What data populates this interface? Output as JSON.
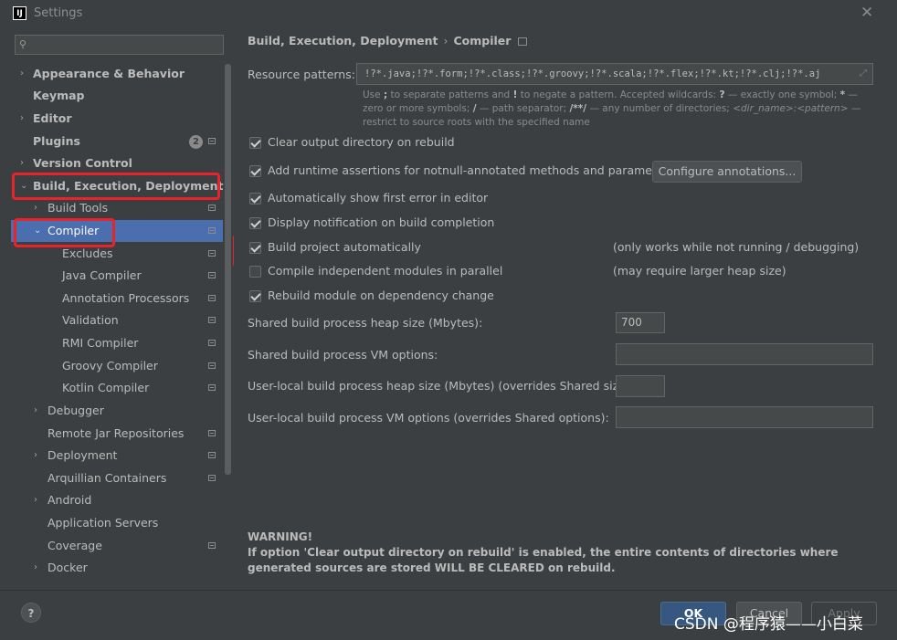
{
  "window": {
    "title": "Settings",
    "logo_text": "IJ"
  },
  "search": {
    "placeholder": ""
  },
  "sidebar": {
    "items": [
      {
        "label": "Appearance & Behavior",
        "arrow": "›"
      },
      {
        "label": "Keymap"
      },
      {
        "label": "Editor",
        "arrow": "›"
      },
      {
        "label": "Plugins",
        "badge": "2"
      },
      {
        "label": "Version Control",
        "arrow": "›"
      },
      {
        "label": "Build, Execution, Deployment",
        "arrow": "⌄"
      },
      {
        "label": "Build Tools",
        "arrow": "›"
      },
      {
        "label": "Compiler",
        "arrow": "⌄"
      },
      {
        "label": "Excludes"
      },
      {
        "label": "Java Compiler"
      },
      {
        "label": "Annotation Processors"
      },
      {
        "label": "Validation"
      },
      {
        "label": "RMI Compiler"
      },
      {
        "label": "Groovy Compiler"
      },
      {
        "label": "Kotlin Compiler"
      },
      {
        "label": "Debugger",
        "arrow": "›"
      },
      {
        "label": "Remote Jar Repositories"
      },
      {
        "label": "Deployment",
        "arrow": "›"
      },
      {
        "label": "Arquillian Containers"
      },
      {
        "label": "Android",
        "arrow": "›"
      },
      {
        "label": "Application Servers"
      },
      {
        "label": "Coverage"
      },
      {
        "label": "Docker",
        "arrow": "›"
      }
    ]
  },
  "breadcrumb": {
    "parent": "Build, Execution, Deployment",
    "separator": "›",
    "current": "Compiler"
  },
  "resource_patterns": {
    "label": "Resource patterns:",
    "value": "!?*.java;!?*.form;!?*.class;!?*.groovy;!?*.scala;!?*.flex;!?*.kt;!?*.clj;!?*.aj"
  },
  "hint": {
    "p1": "Use ",
    "b1": ";",
    "p2": " to separate patterns and ",
    "b2": "!",
    "p3": " to negate a pattern. Accepted wildcards: ",
    "b3": "?",
    "p4": " — exactly one symbol; ",
    "b4": "*",
    "p5": " — zero or more symbols; ",
    "b5": "/",
    "p6": " — path separator; ",
    "b6": "/**/",
    "p7": " — any number of directories; ",
    "i1": "<dir_name>:<pattern>",
    "p8": " — restrict to source roots with the specified name"
  },
  "options": {
    "clear_output": "Clear output directory on rebuild",
    "runtime_assertions": "Add runtime assertions for notnull-annotated methods and parameters",
    "configure_annotations": "Configure annotations...",
    "show_first_error": "Automatically show first error in editor",
    "display_notification": "Display notification on build completion",
    "build_auto": "Build project automatically",
    "build_auto_note": "(only works while not running / debugging)",
    "compile_parallel": "Compile independent modules in parallel",
    "compile_parallel_note": "(may require larger heap size)",
    "rebuild_dependency": "Rebuild module on dependency change"
  },
  "fields": {
    "heap_size_label": "Shared build process heap size (Mbytes):",
    "heap_size_value": "700",
    "vm_options_label": "Shared build process VM options:",
    "user_heap_label": "User-local build process heap size (Mbytes) (overrides Shared size):",
    "user_vm_label": "User-local build process VM options (overrides Shared options):"
  },
  "warning": {
    "title": "WARNING!",
    "text": "If option 'Clear output directory on rebuild' is enabled, the entire contents of directories where generated sources are stored WILL BE CLEARED on rebuild."
  },
  "footer": {
    "help": "?",
    "ok": "OK",
    "cancel": "Cancel",
    "apply": "Apply",
    "watermark": "CSDN @程序猿——小白菜"
  },
  "colors": {
    "selection": "#4b6eaf",
    "highlight": "#e8232a",
    "ok_button": "#365880"
  }
}
